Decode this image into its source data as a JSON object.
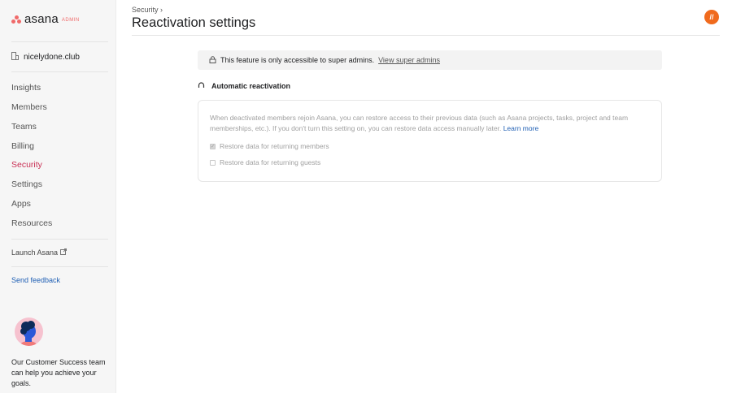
{
  "sidebar": {
    "logo": {
      "word": "asana",
      "suffix": "ADMIN"
    },
    "domain": "nicelydone.club",
    "items": [
      {
        "label": "Insights"
      },
      {
        "label": "Members"
      },
      {
        "label": "Teams"
      },
      {
        "label": "Billing"
      },
      {
        "label": "Security",
        "active": true
      },
      {
        "label": "Settings"
      },
      {
        "label": "Apps"
      },
      {
        "label": "Resources"
      }
    ],
    "launch": "Launch Asana",
    "feedback": "Send feedback",
    "cs_text": "Our Customer Success team can help you achieve your goals."
  },
  "header": {
    "breadcrumb": "Security",
    "title": "Reactivation settings"
  },
  "banner": {
    "text": "This feature is only accessible to super admins.",
    "link": "View super admins"
  },
  "section": {
    "title": "Automatic reactivation",
    "description": "When deactivated members rejoin Asana, you can restore access to their previous data (such as Asana projects, tasks, project and team memberships, etc.). If you don't turn this setting on, you can restore data access manually later.",
    "learn_more": "Learn more",
    "options": [
      {
        "label": "Restore data for returning members",
        "checked": true
      },
      {
        "label": "Restore data for returning guests",
        "checked": false
      }
    ]
  },
  "colors": {
    "accent": "#c92f54",
    "brand": "#f06a6a",
    "link": "#1f5fb4"
  }
}
